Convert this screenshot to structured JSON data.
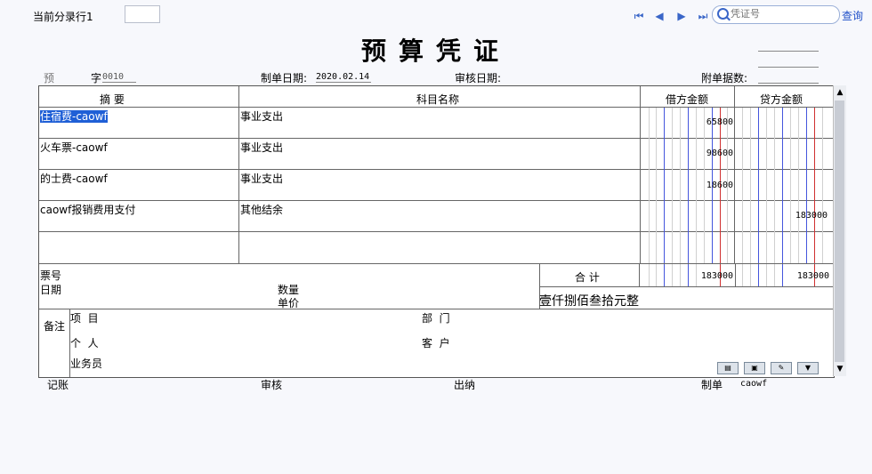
{
  "toolbar": {
    "current_row_label": "当前分录行1",
    "nav_first": "⏮",
    "nav_prev": "◀",
    "nav_next": "▶",
    "nav_last": "⏭",
    "search_placeholder": "凭证号",
    "search_link": "查询"
  },
  "voucher": {
    "title": "预算凭证",
    "type_value": "预",
    "zi_label": "字",
    "number": "0010",
    "date_label": "制单日期:",
    "date_value": "2020.02.14",
    "audit_date_label": "审核日期:",
    "attachments_label": "附单据数:"
  },
  "table": {
    "headers": {
      "summary": "摘 要",
      "account": "科目名称",
      "debit": "借方金额",
      "credit": "贷方金额"
    },
    "rows": [
      {
        "summary": "住宿费-caowf",
        "account": "事业支出",
        "debit": "65800",
        "credit": ""
      },
      {
        "summary": "火车票-caowf",
        "account": "事业支出",
        "debit": "98600",
        "credit": ""
      },
      {
        "summary": "的士费-caowf",
        "account": "事业支出",
        "debit": "18600",
        "credit": ""
      },
      {
        "summary": "caowf报销费用支付",
        "account": "其他结余",
        "debit": "",
        "credit": "183000"
      },
      {
        "summary": "",
        "account": "",
        "debit": "",
        "credit": ""
      }
    ]
  },
  "footer": {
    "ticket_no_label": "票号",
    "date_label": "日期",
    "qty_label": "数量",
    "price_label": "单价",
    "total_label": "合 计",
    "total_debit": "183000",
    "total_credit": "183000",
    "total_in_words": "壹仟捌佰叁拾元整",
    "remark_label": "备注",
    "project_label": "项  目",
    "dept_label": "部  门",
    "person_label": "个  人",
    "customer_label": "客  户",
    "salesman_label": "业务员"
  },
  "signatures": {
    "bookkeeping_label": "记账",
    "audit_label": "审核",
    "cashier_label": "出纳",
    "maker_label": "制单",
    "maker_value": "caowf"
  }
}
